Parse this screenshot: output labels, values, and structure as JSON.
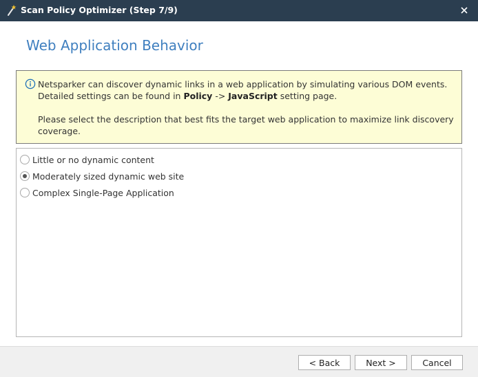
{
  "window": {
    "title": "Scan Policy Optimizer (Step 7/9)",
    "close_icon": "close-icon",
    "app_icon": "magic-wand-icon"
  },
  "page": {
    "heading": "Web Application Behavior"
  },
  "info": {
    "icon": "info-icon",
    "text_before_policy": "Netsparker can discover dynamic links in a web application by simulating various DOM events. Detailed settings can be found in ",
    "policy": "Policy",
    "arrow": " -> ",
    "javascript": "JavaScript",
    "text_after": " setting page.",
    "paragraph2": "Please select the description that best fits the target web application to maximize link discovery coverage."
  },
  "options": {
    "items": [
      {
        "label": "Little or no dynamic content",
        "selected": false
      },
      {
        "label": "Moderately sized dynamic web site",
        "selected": true
      },
      {
        "label": "Complex Single-Page Application",
        "selected": false
      }
    ]
  },
  "footer": {
    "back_label": "< Back",
    "next_label": "Next >",
    "cancel_label": "Cancel"
  },
  "colors": {
    "titlebar": "#2b3e50",
    "heading": "#3f7fbf",
    "info_bg": "#fdfdd6",
    "info_icon": "#1e6fb8"
  }
}
